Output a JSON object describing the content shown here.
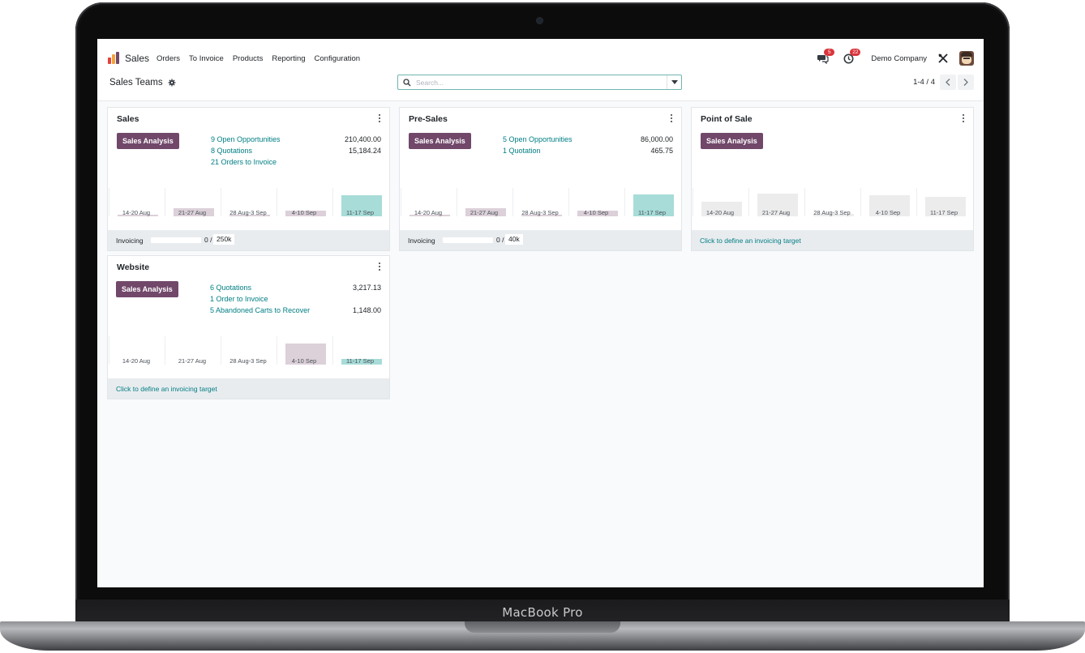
{
  "device": {
    "label": "MacBook Pro"
  },
  "navbar": {
    "app_name": "Sales",
    "menu": [
      "Orders",
      "To Invoice",
      "Products",
      "Reporting",
      "Configuration"
    ],
    "messages_count": "5",
    "activities_count": "22",
    "company": "Demo Company"
  },
  "control_panel": {
    "breadcrumb": "Sales Teams",
    "search_placeholder": "Search...",
    "pager": "1-4 / 4"
  },
  "colors": {
    "primary": "#71486a",
    "link": "#017e84",
    "bar_past": "#dcd0d9",
    "bar_current": "#a7dcd8",
    "bar_empty": "#ececec"
  },
  "teams": [
    {
      "name": "Sales",
      "button": "Sales Analysis",
      "stats": [
        {
          "label": "9 Open Opportunities",
          "amount": "210,400.00"
        },
        {
          "label": "8 Quotations",
          "amount": "15,184.24"
        },
        {
          "label": "21 Orders to Invoice",
          "amount": ""
        }
      ],
      "chart_data": {
        "type": "bar",
        "categories": [
          "14-20 Aug",
          "21-27 Aug",
          "28 Aug-3 Sep",
          "4-10 Sep",
          "11-17 Sep"
        ],
        "values": [
          0.02,
          0.3,
          0.05,
          0.22,
          0.8
        ],
        "current_index": 4
      },
      "footer": {
        "type": "invoicing",
        "label": "Invoicing",
        "current": "0 /",
        "target": "250k",
        "progress": 0
      }
    },
    {
      "name": "Pre-Sales",
      "button": "Sales Analysis",
      "stats": [
        {
          "label": "5 Open Opportunities",
          "amount": "86,000.00"
        },
        {
          "label": "1 Quotation",
          "amount": "465.75"
        }
      ],
      "chart_data": {
        "type": "bar",
        "categories": [
          "14-20 Aug",
          "21-27 Aug",
          "28 Aug-3 Sep",
          "4-10 Sep",
          "11-17 Sep"
        ],
        "values": [
          0.02,
          0.3,
          0.02,
          0.2,
          0.82
        ],
        "current_index": 4
      },
      "footer": {
        "type": "invoicing",
        "label": "Invoicing",
        "current": "0 /",
        "target": "40k",
        "progress": 0
      }
    },
    {
      "name": "Point of Sale",
      "button": "Sales Analysis",
      "stats": [],
      "chart_data": {
        "type": "bar",
        "categories": [
          "14-20 Aug",
          "21-27 Aug",
          "28 Aug-3 Sep",
          "4-10 Sep",
          "11-17 Sep"
        ],
        "values": [
          0.55,
          0.85,
          0.08,
          0.78,
          0.72
        ],
        "current_index": -1,
        "sample": true
      },
      "footer": {
        "type": "link",
        "label": "Click to define an invoicing target"
      }
    },
    {
      "name": "Website",
      "button": "Sales Analysis",
      "stats": [
        {
          "label": "6 Quotations",
          "amount": "3,217.13"
        },
        {
          "label": "1 Order to Invoice",
          "amount": ""
        },
        {
          "label": "5  Abandoned Carts to Recover",
          "amount": "1,148.00"
        }
      ],
      "chart_data": {
        "type": "bar",
        "categories": [
          "14-20 Aug",
          "21-27 Aug",
          "28 Aug-3 Sep",
          "4-10 Sep",
          "11-17 Sep"
        ],
        "values": [
          0,
          0,
          0,
          0.8,
          0.2
        ],
        "current_index": 4
      },
      "footer": {
        "type": "link",
        "label": "Click to define an invoicing target"
      }
    }
  ]
}
